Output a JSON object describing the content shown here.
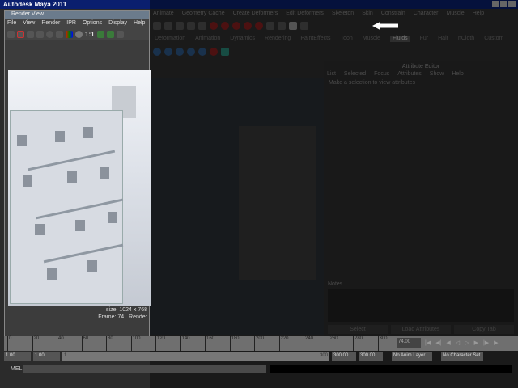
{
  "app_title": "Autodesk Maya 2011",
  "main_menu": [
    "Animate",
    "Geometry Cache",
    "Create Deformers",
    "Edit Deformers",
    "Skeleton",
    "Skin",
    "Constrain",
    "Character",
    "Muscle",
    "Help"
  ],
  "shelf_tabs": [
    "Deformation",
    "Animation",
    "Dynamics",
    "Rendering",
    "PaintEffects",
    "Toon",
    "Muscle",
    "Fluids",
    "Fur",
    "Hair",
    "nCloth",
    "Custom"
  ],
  "active_shelf_tab": "Fluids",
  "attribute_editor": {
    "title": "Attribute Editor",
    "menu": [
      "List",
      "Selected",
      "Focus",
      "Attributes",
      "Show",
      "Help"
    ],
    "message": "Make a selection to view attributes",
    "notes_label": "Notes",
    "buttons": [
      "Select",
      "Load Attributes",
      "Copy Tab"
    ]
  },
  "render_view": {
    "title": "Render View",
    "menu": [
      "File",
      "View",
      "Render",
      "IPR",
      "Options",
      "Display",
      "Help"
    ],
    "ratio_label": "1:1",
    "size_text": "size: 1024 x 768",
    "frame_text": "Frame: 74",
    "render_text": "Render"
  },
  "timeline": {
    "ticks": [
      "0",
      "20",
      "40",
      "60",
      "80",
      "100",
      "120",
      "140",
      "160",
      "180",
      "200",
      "220",
      "240",
      "260",
      "280",
      "300"
    ],
    "current_frame": "74.00"
  },
  "range": {
    "start": "1.00",
    "start2": "1.00",
    "slider_start": "1",
    "slider_end": "300",
    "end": "300.00",
    "end2": "300.00",
    "anim_layer": "No Anim Layer",
    "character_set": "No Character Set"
  },
  "command_line": {
    "label": "MEL"
  }
}
